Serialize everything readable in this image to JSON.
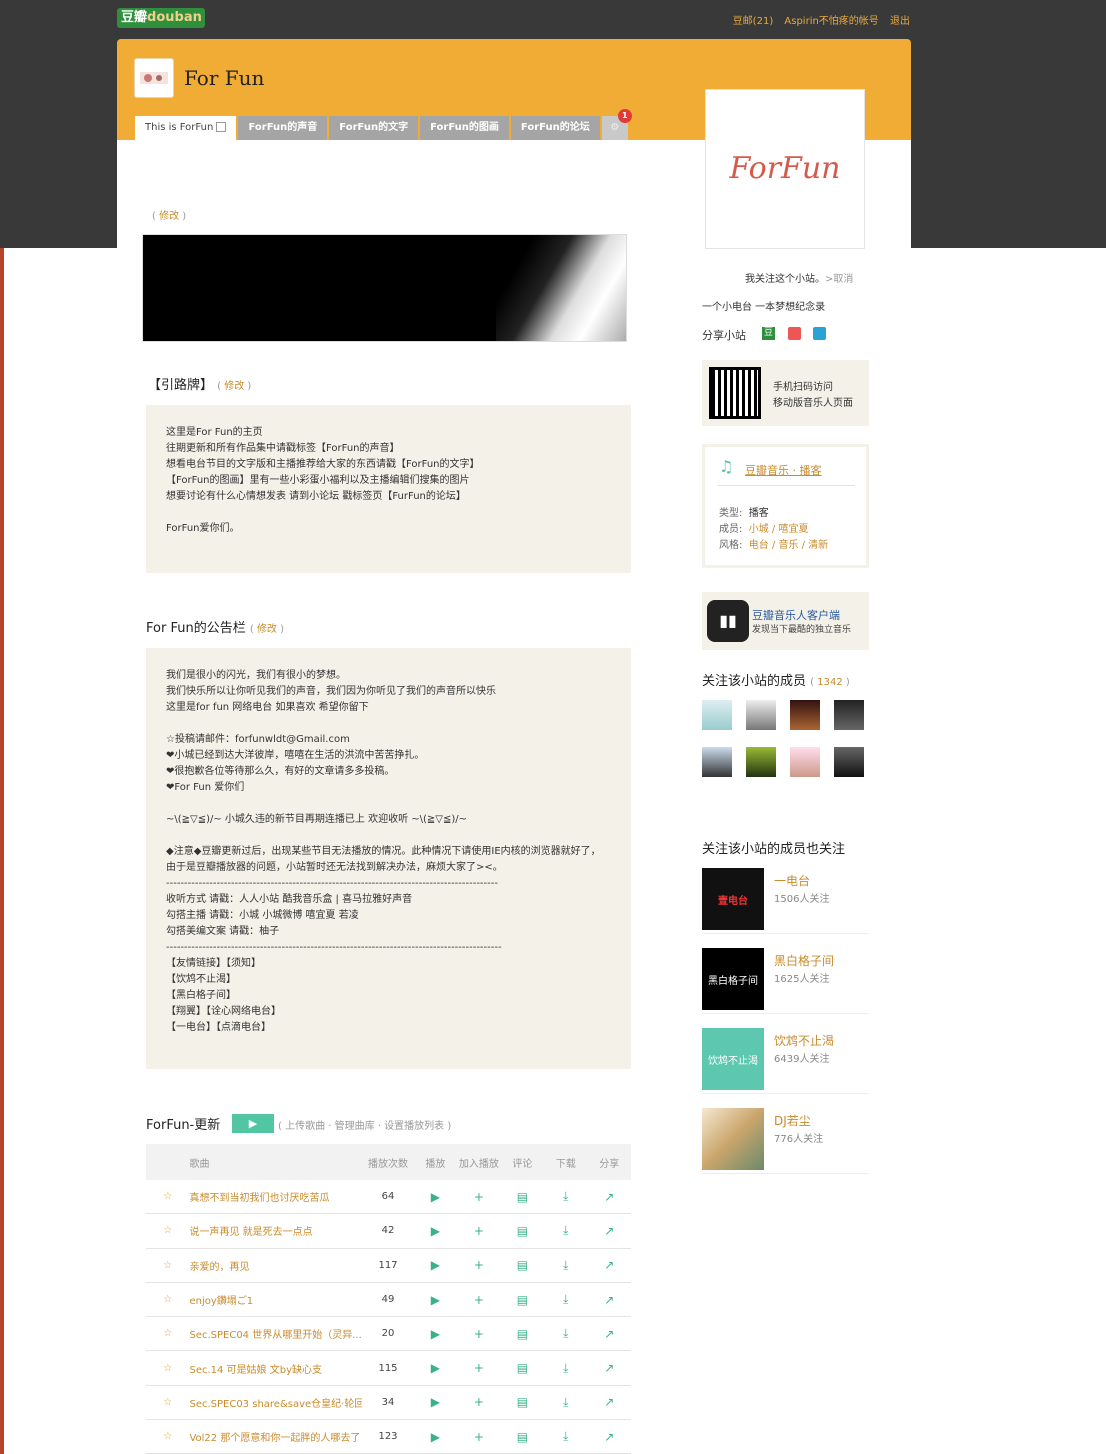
{
  "topbar": {
    "logo_zh": "豆瓣",
    "logo_en": "douban",
    "mail": "豆邮(21)",
    "account": "Aspirin不怕疼的帐号",
    "logout": "退出"
  },
  "site": {
    "title": "For Fun"
  },
  "tabs": [
    {
      "label": "This is ForFun"
    },
    {
      "label": "ForFun的声音"
    },
    {
      "label": "ForFun的文字"
    },
    {
      "label": "ForFun的图画"
    },
    {
      "label": "ForFun的论坛"
    }
  ],
  "tab_badge": "1",
  "edit": "修改",
  "guide": {
    "title": "【引路牌】",
    "lines": [
      "这里是For Fun的主页",
      "往期更新和所有作品集中请戳标签【ForFun的声音】",
      "想看电台节目的文字版和主播推荐给大家的东西请戳【ForFun的文字】",
      "【ForFun的图画】里有一些小彩蛋小福利以及主播编辑们搜集的图片",
      "想要讨论有什么心情想发表 请到小论坛 戳标签页【FurFun的论坛】",
      "",
      "ForFun爱你们。"
    ]
  },
  "notice": {
    "title": "For Fun的公告栏",
    "lines": [
      "我们是很小的闪光，我们有很小的梦想。",
      "我们快乐所以让你听见我们的声音，我们因为你听见了我们的声音所以快乐",
      "这里是for fun 网络电台 如果喜欢 希望你留下",
      "",
      "☆投稿请邮件：forfunwldt@Gmail.com",
      "❤小城已经到达大洋彼岸，嘻嘻在生活的洪流中苦苦挣扎。",
      "❤很抱歉各位等待那么久，有好的文章请多多投稿。",
      "❤For Fun 爱你们",
      "",
      "     ~\\(≧▽≦)/~ 小城久违的新节目再期连播已上 欢迎收听 ~\\(≧▽≦)/~",
      "",
      "◆注意◆豆瓣更新过后，出现某些节目无法播放的情况。此种情况下请使用IE内核的浏览器就好了，",
      "由于是豆瓣播放器的问题，小站暂时还无法找到解决办法，麻烦大家了><。",
      "--------------------------------------------------------------------------------------------",
      "收听方式 请戳：人人小站  酷我音乐盒  |  喜马拉雅好声音",
      "勾搭主播 请戳：小城 小城微博 嘻宜夏 若凌",
      "勾搭美编文案 请戳：柚子",
      "---------------------------------------------------------------------------------------------",
      "【友情链接】【须知】",
      "【饮鸩不止渴】",
      "【黑白格子间】",
      "【翔翼】【诠心网络电台】",
      "【一电台】【点滴电台】"
    ]
  },
  "playlist": {
    "title": "ForFun-更新",
    "actions": "( 上传歌曲 · 管理曲库 · 设置播放列表 )",
    "headers": {
      "song": "歌曲",
      "plays": "播放次数",
      "play": "播放",
      "add": "加入播放",
      "comment": "评论",
      "download": "下载",
      "share": "分享"
    },
    "songs": [
      {
        "name": "真想不到当初我们也讨厌吃苦瓜",
        "plays": "64"
      },
      {
        "name": "说一声再见 就是死去一点点",
        "plays": "42"
      },
      {
        "name": "亲爱的，再见",
        "plays": "117"
      },
      {
        "name": "enjoy鑽塌ご1",
        "plays": "49"
      },
      {
        "name": "Sec.SPEC04 世界从哪里开始（灵异...",
        "plays": "20"
      },
      {
        "name": "Sec.14 可是姑娘 文by缺心支",
        "plays": "115"
      },
      {
        "name": "Sec.SPEC03 share&save仓皇纪·轮回",
        "plays": "34"
      },
      {
        "name": "Vol22 那个愿意和你一起胖的人哪去了",
        "plays": "123"
      }
    ]
  },
  "sidebar": {
    "logo_text": "ForFun",
    "follow": "我关注这个小站。",
    "cancel": ">取消",
    "slogan": "一个小电台 一本梦想纪念录",
    "share": "分享小站",
    "qr_line1": "手机扫码访问",
    "qr_line2": "移动版音乐人页面",
    "music_link": "豆瓣音乐 · 播客",
    "type_label": "类型:",
    "type_value": "播客",
    "members_label": "成员:",
    "members_value": "小城 / 嘻宜夏",
    "style_label": "风格:",
    "style_value": "电台 / 音乐 / 清新",
    "client_title": "豆瓣音乐人客户端",
    "client_sub": "发现当下最酷的独立音乐",
    "followers_title": "关注该小站的成员",
    "followers_count": "1342",
    "also_title": "关注该小站的成员也关注",
    "related": [
      {
        "name": "一电台",
        "count": "1506人关注",
        "thumb": "壹电台"
      },
      {
        "name": "黑白格子间",
        "count": "1625人关注",
        "thumb": "黑白格子间"
      },
      {
        "name": "饮鸩不止渴",
        "count": "6439人关注",
        "thumb": "饮鸩不止渴"
      },
      {
        "name": "DJ若尘",
        "count": "776人关注",
        "thumb": ""
      }
    ]
  },
  "colors": {
    "accent": "#f1ac35",
    "link": "#c98b2b",
    "green": "#52c5a3"
  }
}
